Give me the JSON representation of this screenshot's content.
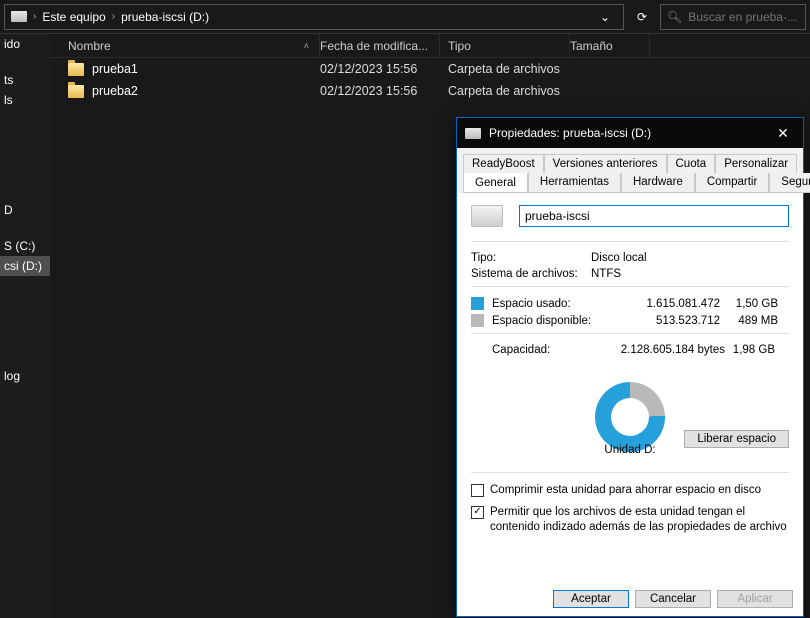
{
  "breadcrumb": {
    "root": "Este equipo",
    "current": "prueba-iscsi (D:)"
  },
  "search": {
    "placeholder": "Buscar en prueba-..."
  },
  "columns": {
    "name": "Nombre",
    "modified": "Fecha de modifica...",
    "type": "Tipo",
    "size": "Tamaño"
  },
  "rows": [
    {
      "name": "prueba1",
      "date": "02/12/2023 15:56",
      "type": "Carpeta de archivos"
    },
    {
      "name": "prueba2",
      "date": "02/12/2023 15:56",
      "type": "Carpeta de archivos"
    }
  ],
  "sidebar": {
    "a": "ido",
    "b": "ts",
    "c": "ls",
    "d": "D",
    "e": "S (C:)",
    "f": "csi (D:)",
    "g": "log"
  },
  "dialog": {
    "title": "Propiedades: prueba-iscsi (D:)",
    "tabsTop": {
      "readyboost": "ReadyBoost",
      "versions": "Versiones anteriores",
      "quota": "Cuota",
      "personalize": "Personalizar"
    },
    "tabsBottom": {
      "general": "General",
      "tools": "Herramientas",
      "hardware": "Hardware",
      "share": "Compartir",
      "security": "Seguridad"
    },
    "nameValue": "prueba-iscsi",
    "typeLabel": "Tipo:",
    "typeValue": "Disco local",
    "fsLabel": "Sistema de archivos:",
    "fsValue": "NTFS",
    "usedLabel": "Espacio usado:",
    "usedBytes": "1.615.081.472",
    "usedH": "1,50 GB",
    "freeLabel": "Espacio disponible:",
    "freeBytes": "513.523.712",
    "freeH": "489 MB",
    "capLabel": "Capacidad:",
    "capBytes": "2.128.605.184 bytes",
    "capH": "1,98 GB",
    "unitLabel": "Unidad D:",
    "liberar": "Liberar espacio",
    "compress": "Comprimir esta unidad para ahorrar espacio en disco",
    "index": "Permitir que los archivos de esta unidad tengan el contenido indizado además de las propiedades de archivo",
    "ok": "Aceptar",
    "cancel": "Cancelar",
    "apply": "Aplicar"
  }
}
